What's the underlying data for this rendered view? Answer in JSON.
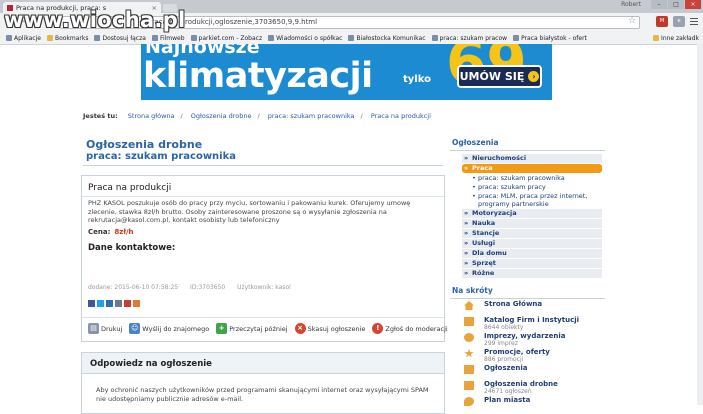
{
  "browser": {
    "tab_title": "Praca na produkcji, praca: s",
    "user_label": "Robert",
    "url": "praca-na-produkcji,ogloszenie,3703650,9,9.html",
    "bookmarks": [
      "Aplikacje",
      "Bookmarks",
      "Dostosuj łącza",
      "Filmweb",
      "parkiet.com - Zobacz",
      "Wiadomości o spółkac",
      "Białostocka Komunikac",
      "praca: szukam pracow",
      "Praca białystok - ofert"
    ],
    "other_bookmarks": "Inne zakładk"
  },
  "watermark": "www.wiocha.pl",
  "banner": {
    "line1": "Najnowsze",
    "line2": "klimatyzacji",
    "tylko": "tylko",
    "price": "69",
    "cta": "UMÓW SIĘ",
    "colors": {
      "bg": "#1c8bd2",
      "accent": "#f6c414"
    }
  },
  "breadcrumb": {
    "label": "Jesteś tu:",
    "items": [
      "Strona główna",
      "Ogłoszenia drobne",
      "praca: szukam pracownika",
      "Praca na produkcji"
    ]
  },
  "page": {
    "title": "Ogłoszenia drobne",
    "subtitle": "praca: szukam pracownika"
  },
  "ad": {
    "title": "Praca na produkcji",
    "text": "PHZ KASOL poszukuje osób do pracy przy myciu, sortowaniu i pakowaniu kurek. Oferujemy umowę zlecenie, stawka 8zł/h brutto. Osoby zainteresowane proszone są o wysyłanie zgłoszenia na rekrutacja@kasol.com.pl, kontakt osobisty lub telefoniczny",
    "price_label": "Cena:",
    "price_value": "8zł/h",
    "contact_label": "Dane kontaktowe:",
    "meta": {
      "added": "dodane: 2015-06-10 07:58:25",
      "id": "ID:3703650",
      "user": "Użytkownik: kasol"
    },
    "actions": [
      "Drukuj",
      "Wyślij do znajomego",
      "Przeczytaj później",
      "Skasuj ogłoszenie",
      "Zgłoś do moderacji"
    ]
  },
  "reply": {
    "title": "Odpowiedz na ogłoszenie",
    "text": "Aby ochronić naszych użytkowników przed programami skanującymi internet oraz wysyłającymi SPAM nie udostępniamy publicznie adresów e-mail."
  },
  "sidebar": {
    "heading": "Ogłoszenia",
    "categories": [
      {
        "label": "Nieruchomości",
        "active": false
      },
      {
        "label": "Praca",
        "active": true
      },
      {
        "label": "Motoryzacja",
        "active": false
      },
      {
        "label": "Nauka",
        "active": false
      },
      {
        "label": "Stancje",
        "active": false
      },
      {
        "label": "Usługi",
        "active": false
      },
      {
        "label": "Dla domu",
        "active": false
      },
      {
        "label": "Sprzęt",
        "active": false
      },
      {
        "label": "Różne",
        "active": false
      }
    ],
    "praca_sub": [
      "praca: szukam pracownika",
      "praca: szukam pracy",
      "praca: MLM, praca przez internet, programy partnerskie"
    ],
    "shortcuts_heading": "Na skróty",
    "shortcuts": [
      {
        "label": "Strona Główna",
        "count": ""
      },
      {
        "label": "Katalog Firm i Instytucji",
        "count": "8644 obiekty"
      },
      {
        "label": "Imprezy, wydarzenia",
        "count": "299 imprez"
      },
      {
        "label": "Promocje, oferty",
        "count": "886 promocji"
      },
      {
        "label": "Ogłoszenia",
        "count": ""
      },
      {
        "label": "Ogłoszenia drobne",
        "count": "24671 ogłoszeń"
      },
      {
        "label": "Plan miasta",
        "count": ""
      }
    ]
  }
}
